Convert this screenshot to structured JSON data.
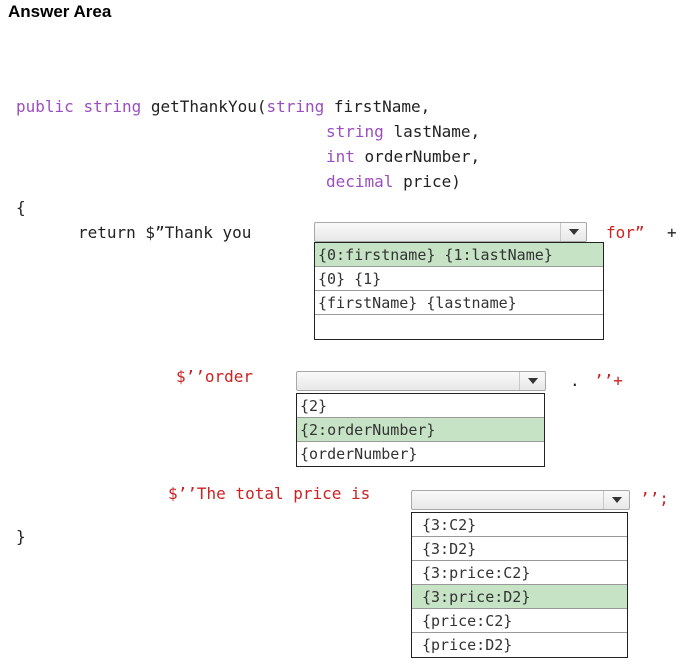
{
  "header": {
    "title": "Answer Area"
  },
  "code": {
    "line1_kw1": "public",
    "line1_kw2": "string",
    "line1_fn": "getThankYou(",
    "line1_kw3": "string",
    "line1_param": "firstName,",
    "line2_kw": "string",
    "line2_param": "lastName,",
    "line3_kw": "int",
    "line3_param": "orderNumber,",
    "line4_kw": "decimal",
    "line4_param": "price)",
    "open_brace": "{",
    "return_text": "return $”Thank you",
    "for_text": "for”",
    "plus1": "+",
    "order_text": "$’’order",
    "dot_text": ".",
    "quote_plus": "’’+",
    "total_text": "$’’The total price is",
    "end_text": "’’;",
    "close_brace": "}"
  },
  "dropdown1": {
    "selected": "",
    "options": [
      {
        "label": "{0:firstname} {1:lastName}",
        "selected": true
      },
      {
        "label": "{0} {1}",
        "selected": false
      },
      {
        "label": "{firstName} {lastname}",
        "selected": false
      },
      {
        "label": "",
        "selected": false
      }
    ]
  },
  "dropdown2": {
    "selected": "",
    "options": [
      {
        "label": "{2}",
        "selected": false
      },
      {
        "label": "{2:orderNumber}",
        "selected": true
      },
      {
        "label": "{orderNumber}",
        "selected": false
      }
    ]
  },
  "dropdown3": {
    "selected": "",
    "options": [
      {
        "label": "{3:C2}",
        "selected": false
      },
      {
        "label": "{3:D2}",
        "selected": false
      },
      {
        "label": "{3:price:C2}",
        "selected": false
      },
      {
        "label": "{3:price:D2}",
        "selected": true
      },
      {
        "label": "{price:C2}",
        "selected": false
      },
      {
        "label": "{price:D2}",
        "selected": false
      }
    ]
  }
}
